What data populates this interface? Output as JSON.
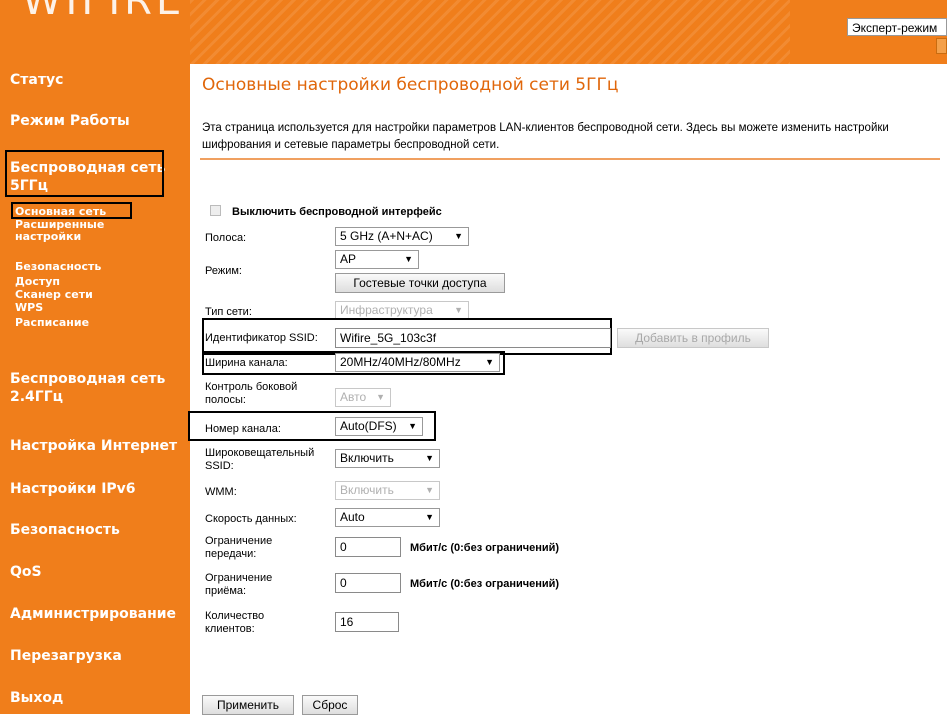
{
  "header": {
    "logo": "WIFIRE",
    "mode_label": "Эксперт-режим"
  },
  "sidebar": {
    "status": "Статус",
    "work_mode": "Режим Работы",
    "wireless5_line1": "Беспроводная сеть",
    "wireless5_line2": "5ГГц",
    "sub5": [
      "Основная сеть",
      "Расширенные",
      "настройки",
      "Безопасность",
      "Доступ",
      "Сканер сети",
      "WPS",
      "Расписание"
    ],
    "wireless24_line1": "Беспроводная сеть",
    "wireless24_line2": "2.4ГГц",
    "internet": "Настройка Интернет",
    "ipv6": "Настройки IPv6",
    "security": "Безопасность",
    "qos": "QoS",
    "admin": "Администрирование",
    "reboot": "Перезагрузка",
    "logout": "Выход"
  },
  "main": {
    "title": "Основные настройки беспроводной сети 5ГГц",
    "description": "Эта страница используется для настройки параметров LAN-клиентов беспроводной сети. Здесь вы можете изменить настройки шифрования и сетевые параметры беспроводной сети."
  },
  "form": {
    "disable_label": "Выключить беспроводной интерфейс",
    "band_label": "Полоса:",
    "band_value": "5 GHz (A+N+AC)",
    "mode_label": "Режим:",
    "mode_value": "AP",
    "guest_button": "Гостевые точки доступа",
    "net_type_label": "Тип сети:",
    "net_type_value": "Инфраструктура",
    "ssid_label": "Идентификатор SSID:",
    "ssid_value": "Wifire_5G_103c3f",
    "add_profile_button": "Добавить в профиль",
    "width_label": "Ширина канала:",
    "width_value": "20MHz/40MHz/80MHz",
    "sideband_label_1": "Контроль боковой",
    "sideband_label_2": "полосы:",
    "sideband_value": "Авто",
    "channel_label": "Номер канала:",
    "channel_value": "Auto(DFS)",
    "broadcast_label_1": "Широковещательный",
    "broadcast_label_2": "SSID:",
    "broadcast_value": "Включить",
    "wmm_label": "WMM:",
    "wmm_value": "Включить",
    "rate_label": "Скорость данных:",
    "rate_value": "Auto",
    "tx_label_1": "Ограничение",
    "tx_label_2": "передачи:",
    "tx_value": "0",
    "tx_unit": "Мбит/с (0:без ограничений)",
    "rx_label_1": "Ограничение",
    "rx_label_2": "приёма:",
    "rx_value": "0",
    "rx_unit": "Мбит/с (0:без ограничений)",
    "clients_label_1": "Количество",
    "clients_label_2": "клиентов:",
    "clients_value": "16",
    "apply_button": "Применить",
    "reset_button": "Сброс"
  }
}
